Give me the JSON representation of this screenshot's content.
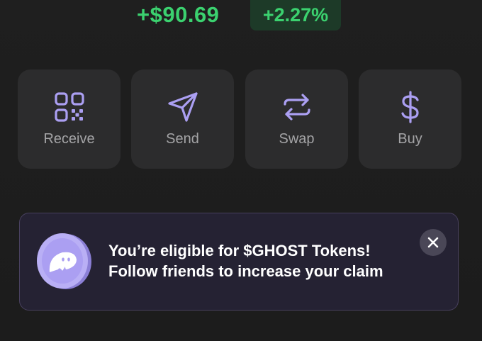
{
  "balance_change": {
    "amount": "+$90.69",
    "percent": "+2.27%",
    "color": "#3bd16f"
  },
  "actions": [
    {
      "label": "Receive",
      "icon": "qr-code-icon"
    },
    {
      "label": "Send",
      "icon": "send-arrow-icon"
    },
    {
      "label": "Swap",
      "icon": "swap-arrows-icon"
    },
    {
      "label": "Buy",
      "icon": "dollar-icon"
    }
  ],
  "accent_color": "#ab9ff2",
  "banner": {
    "line1": "You’re eligible for $GHOST Tokens!",
    "line2": "Follow friends to increase your claim",
    "icon": "ghost-coin-icon",
    "close_icon": "close-icon"
  }
}
